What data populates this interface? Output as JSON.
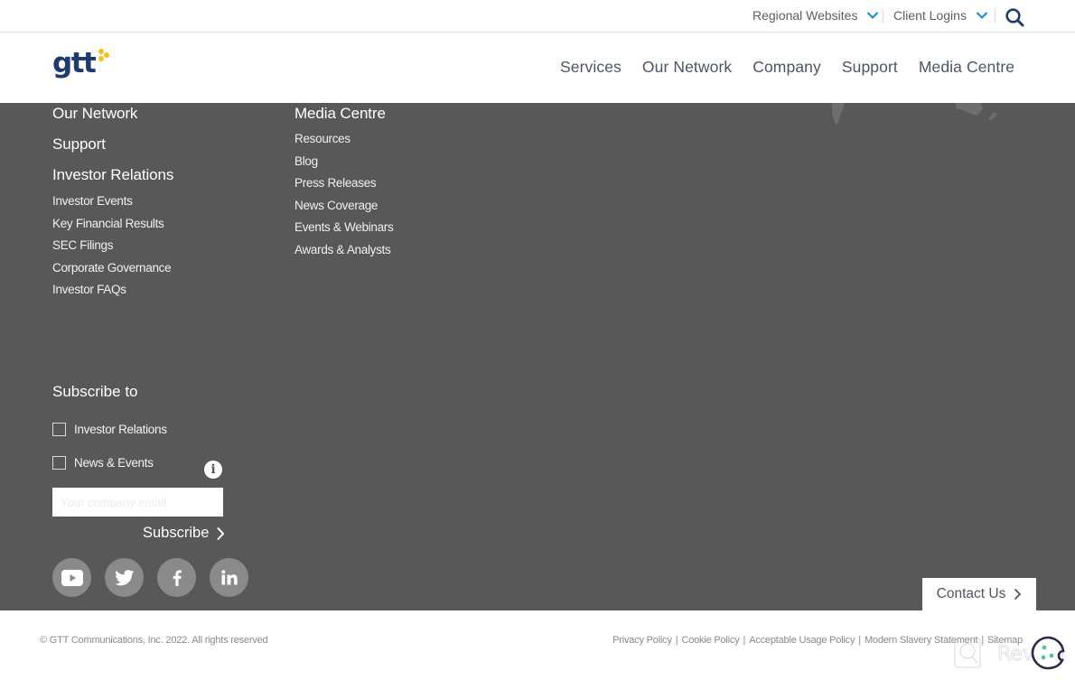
{
  "utility_bar": {
    "regional_websites": "Regional Websites",
    "client_logins": "Client Logins",
    "search_icon": "search-icon",
    "chevron_color": "#1a8fd6"
  },
  "header": {
    "logo_text": "gtt",
    "logo_colors": {
      "text": "#1f3a6e",
      "dots": "#f2c21b"
    },
    "nav": [
      {
        "label": "Services"
      },
      {
        "label": "Our Network"
      },
      {
        "label": "Company"
      },
      {
        "label": "Support"
      },
      {
        "label": "Media Centre"
      }
    ]
  },
  "footer": {
    "background": "#585858",
    "column_left": {
      "headings": [
        "Our Network",
        "Support",
        "Investor Relations"
      ],
      "links": [
        "Investor Events",
        "Key Financial Results",
        "SEC Filings",
        "Corporate Governance",
        "Investor FAQs"
      ]
    },
    "column_media": {
      "heading": "Media Centre",
      "links": [
        "Resources",
        "Blog",
        "Press Releases",
        "News Coverage",
        "Events & Webinars",
        "Awards & Analysts"
      ]
    },
    "subscribe": {
      "title": "Subscribe to",
      "options": [
        {
          "label": "Investor Relations",
          "checked": false
        },
        {
          "label": "News & Events",
          "checked": false
        }
      ],
      "info_icon": "i",
      "email_placeholder": "Your company email",
      "button_label": "Subscribe"
    },
    "socials": [
      {
        "name": "youtube"
      },
      {
        "name": "twitter"
      },
      {
        "name": "facebook"
      },
      {
        "name": "linkedin"
      }
    ],
    "contact_button": "Contact Us"
  },
  "legal": {
    "copyright": "© GTT Communications, Inc. 2022. All rights reserved",
    "links": [
      "Privacy Policy",
      "Cookie Policy",
      "Acceptable Usage Policy",
      "Modern Slavery Statement",
      "Sitemap"
    ],
    "separator": "|",
    "watermark": "Revain"
  }
}
